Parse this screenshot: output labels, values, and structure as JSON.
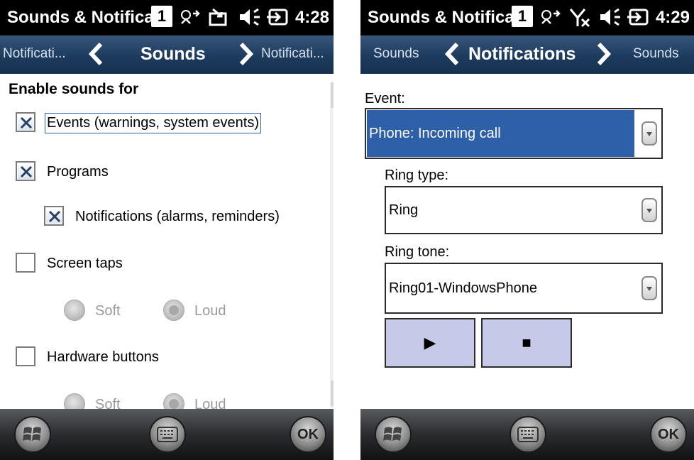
{
  "left_screen": {
    "status": {
      "title": "Sounds & Notifica",
      "badge": "1",
      "time": "4:28",
      "icons": [
        "network-icon",
        "message-icon",
        "volume-icon",
        "battery-icon"
      ]
    },
    "nav": {
      "prev": "Notificati...",
      "current": "Sounds",
      "next": "Notificati..."
    },
    "section_heading": "Enable sounds for",
    "checkboxes": [
      {
        "label": "Events (warnings, system events)",
        "checked": true
      },
      {
        "label": "Programs",
        "checked": true
      },
      {
        "label": "Notifications (alarms, reminders)",
        "checked": true
      },
      {
        "label": "Screen taps",
        "checked": false
      },
      {
        "label": "Hardware buttons",
        "checked": false
      }
    ],
    "screen_taps_radios": {
      "soft": "Soft",
      "loud": "Loud",
      "selected": "loud"
    },
    "hardware_radios": {
      "soft": "Soft",
      "loud": "Loud",
      "selected": "loud"
    }
  },
  "right_screen": {
    "status": {
      "title": "Sounds & Notifica",
      "badge": "1",
      "time": "4:29",
      "icons": [
        "network-icon",
        "no-signal-icon",
        "volume-icon",
        "battery-icon"
      ]
    },
    "nav": {
      "prev": "Sounds",
      "current": "Notifications",
      "next": "Sounds"
    },
    "event_label": "Event:",
    "event_value": "Phone: Incoming call",
    "ring_type_label": "Ring type:",
    "ring_type_value": "Ring",
    "ring_tone_label": "Ring tone:",
    "ring_tone_value": "Ring01-WindowsPhone",
    "play_glyph": "▶",
    "stop_glyph": "■"
  },
  "softkeys": {
    "ok": "OK"
  },
  "colors": {
    "selection": "#2e5fa9",
    "nav_bar": "#1d3b5e",
    "media_button": "#c6c9e8"
  }
}
